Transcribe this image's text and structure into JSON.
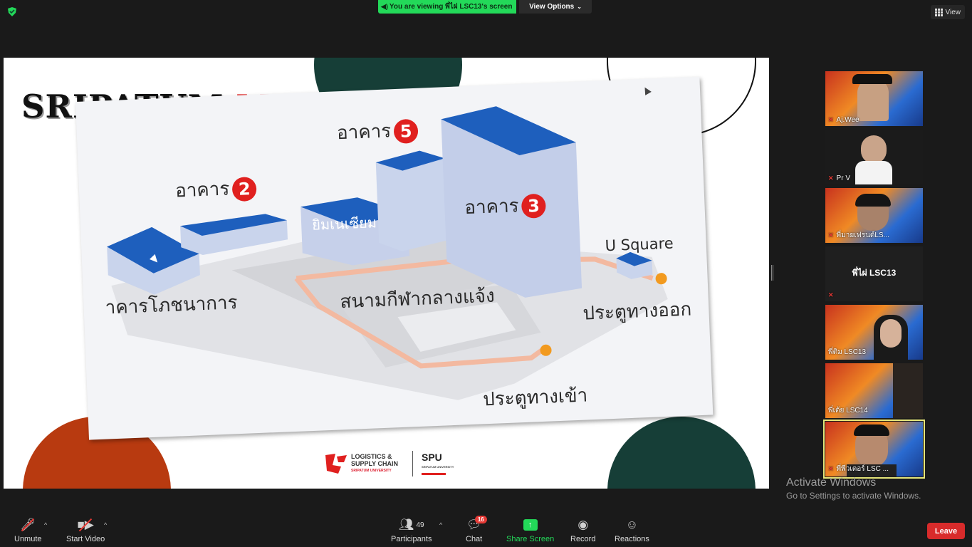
{
  "top": {
    "viewing_text": "You are viewing พี่ไผ่ LSC13's screen",
    "view_options": "View Options",
    "view_button": "View"
  },
  "slide": {
    "title_black": "SRIPATUM",
    "title_red": "MAP",
    "labels": {
      "building2": "อาคาร",
      "building2_num": "2",
      "building5": "อาคาร",
      "building5_num": "5",
      "building3": "อาคาร",
      "building3_num": "3",
      "gym": "ยิมเนเซียม",
      "canteen": "าคารโภชนาการ",
      "field": "สนามกีฬากลางแจ้ง",
      "usquare": "U Square",
      "exit": "ประตูทางออก",
      "entrance": "ประตูทางเข้า"
    },
    "logo": {
      "lsc_line1": "LOGISTICS &",
      "lsc_line2": "SUPPLY CHAIN",
      "lsc_small": "SRIPATUM UNIVERSITY",
      "spu": "SPU",
      "spu_small": "SRIPATUM UNIVERSITY"
    }
  },
  "participants": [
    {
      "name": "Aj.Wee",
      "muted": true
    },
    {
      "name": "Pr V",
      "muted": true
    },
    {
      "name": "พี่มายเฟรนด์LS...",
      "muted": true
    },
    {
      "name": "พี่ไผ่ LSC13",
      "muted": true
    },
    {
      "name": "พี่ติม LSC13",
      "muted": false
    },
    {
      "name": "พี่เต้ย LSC14",
      "muted": false
    },
    {
      "name": "พี่พีวเตอร์ LSC ...",
      "muted": true
    }
  ],
  "activation": {
    "line1": "Activate Windows",
    "line2": "Go to Settings to activate Windows."
  },
  "toolbar": {
    "unmute": "Unmute",
    "start_video": "Start Video",
    "participants": "Participants",
    "participants_count": "49",
    "chat": "Chat",
    "chat_count": "16",
    "share_screen": "Share Screen",
    "record": "Record",
    "reactions": "Reactions",
    "leave": "Leave"
  },
  "colors": {
    "share_green": "#23d959",
    "leave_red": "#d82b2b",
    "slide_red": "#e0201f",
    "building_blue": "#1e5fbd"
  }
}
